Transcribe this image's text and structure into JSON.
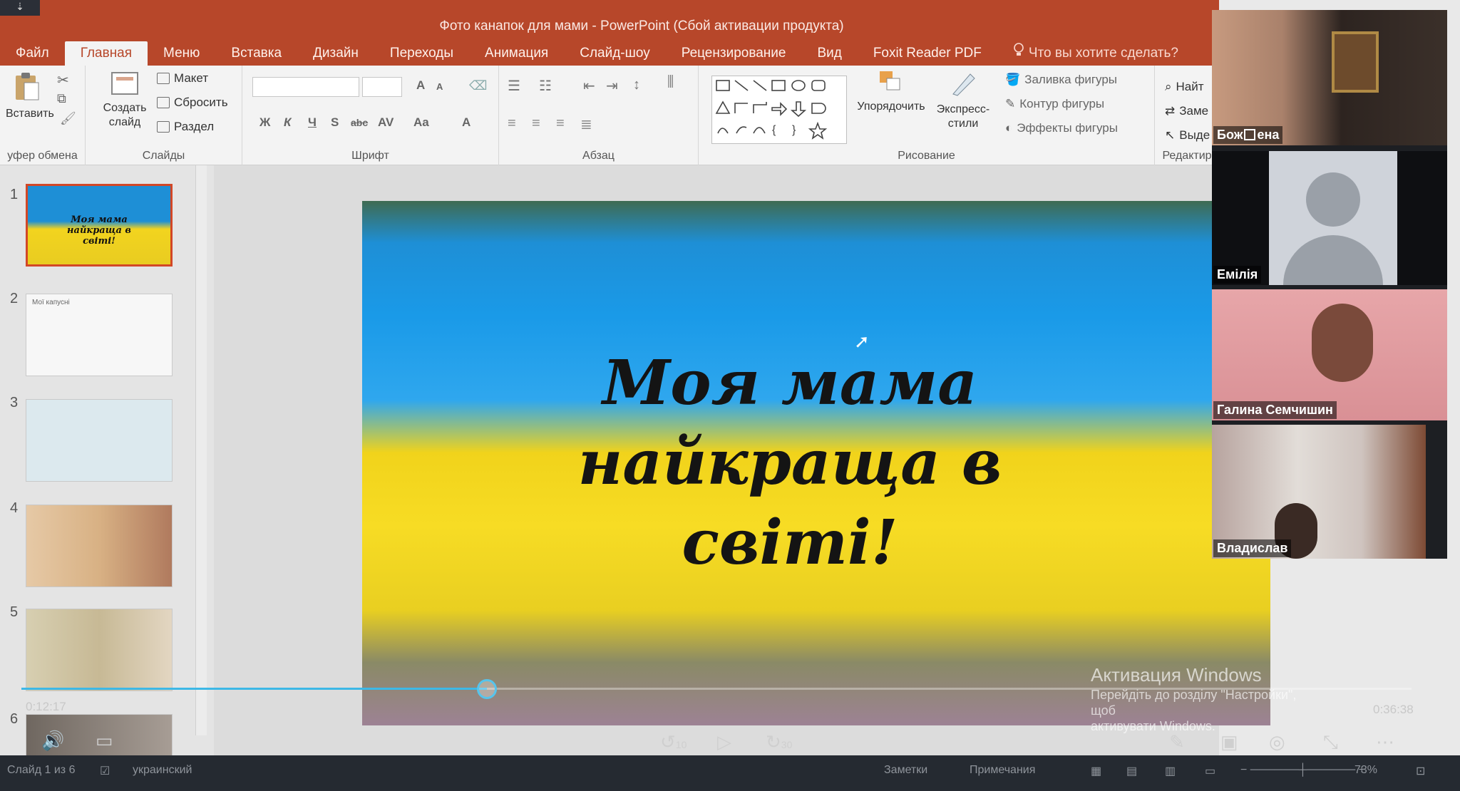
{
  "window": {
    "corner_glyph": "⇣",
    "title": "Фото канапок для мами - PowerPoint (Сбой активации продукта)"
  },
  "ribbon_tabs": [
    {
      "label": "Файл",
      "active": false
    },
    {
      "label": "Главная",
      "active": true
    },
    {
      "label": "Меню",
      "active": false
    },
    {
      "label": "Вставка",
      "active": false
    },
    {
      "label": "Дизайн",
      "active": false
    },
    {
      "label": "Переходы",
      "active": false
    },
    {
      "label": "Анимация",
      "active": false
    },
    {
      "label": "Слайд-шоу",
      "active": false
    },
    {
      "label": "Рецензирование",
      "active": false
    },
    {
      "label": "Вид",
      "active": false
    },
    {
      "label": "Foxit Reader PDF",
      "active": false
    }
  ],
  "tell_me": "Что вы хотите сделать?",
  "ribbon": {
    "clipboard": {
      "paste": "Вставить",
      "group": "уфер обмена"
    },
    "slides": {
      "new_slide": "Создать слайд",
      "layout": "Макет",
      "reset": "Сбросить",
      "section": "Раздел",
      "group": "Слайды"
    },
    "font": {
      "group": "Шрифт",
      "bold": "Ж",
      "italic": "К",
      "underline": "Ч",
      "strike": "S",
      "shadow": "abc",
      "spacing": "AV",
      "case": "Aa",
      "color": "A",
      "grow": "A",
      "shrink": "A"
    },
    "paragraph": {
      "group": "Абзац"
    },
    "drawing": {
      "arrange": "Упорядочить",
      "quick_styles": "Экспресс-стили",
      "fill": "Заливка фигуры",
      "outline": "Контур фигуры",
      "effects": "Эффекты фигуры",
      "group": "Рисование"
    },
    "editing": {
      "find": "Найт",
      "replace": "Заме",
      "select": "Выде",
      "group": "Редактир"
    }
  },
  "thumbnails": [
    {
      "num": "1",
      "caption": "Моя мама найкраща в світі!",
      "selected": true
    },
    {
      "num": "2",
      "caption": "Мої капусні",
      "selected": false
    },
    {
      "num": "3",
      "caption": "",
      "selected": false
    },
    {
      "num": "4",
      "caption": "",
      "selected": false
    },
    {
      "num": "5",
      "caption": "",
      "selected": false
    },
    {
      "num": "6",
      "caption": "",
      "selected": false
    }
  ],
  "slide": {
    "title_line1": "Моя мама",
    "title_line2": "найкраща в",
    "title_line3": "світі!"
  },
  "video": {
    "elapsed": "0:12:17",
    "total": "0:36:38",
    "progress": 0.335,
    "rewind_label": "10",
    "forward_label": "30"
  },
  "activation": {
    "title": "Активация Windows",
    "line1": "Перейдіть до розділу \"Настройки\", щоб",
    "line2": "активувати Windows."
  },
  "statusbar": {
    "slide_of": "Слайд 1 из 6",
    "language": "украинский",
    "notes": "Заметки",
    "comments": "Примечания",
    "zoom": "73%"
  },
  "participants": [
    {
      "name": "Бож",
      "name_rest": "ена",
      "kind": "video-woman-blonde"
    },
    {
      "name": "Емілія",
      "kind": "avatar"
    },
    {
      "name": "Галина Семчишин",
      "kind": "video-woman-glasses"
    },
    {
      "name": "Владислав",
      "kind": "video-man"
    }
  ],
  "colors": {
    "ppt_accent": "#b7472a",
    "progress": "#3db8e6",
    "flag_blue": "#1a9ae8",
    "flag_yellow": "#f7dc24"
  }
}
